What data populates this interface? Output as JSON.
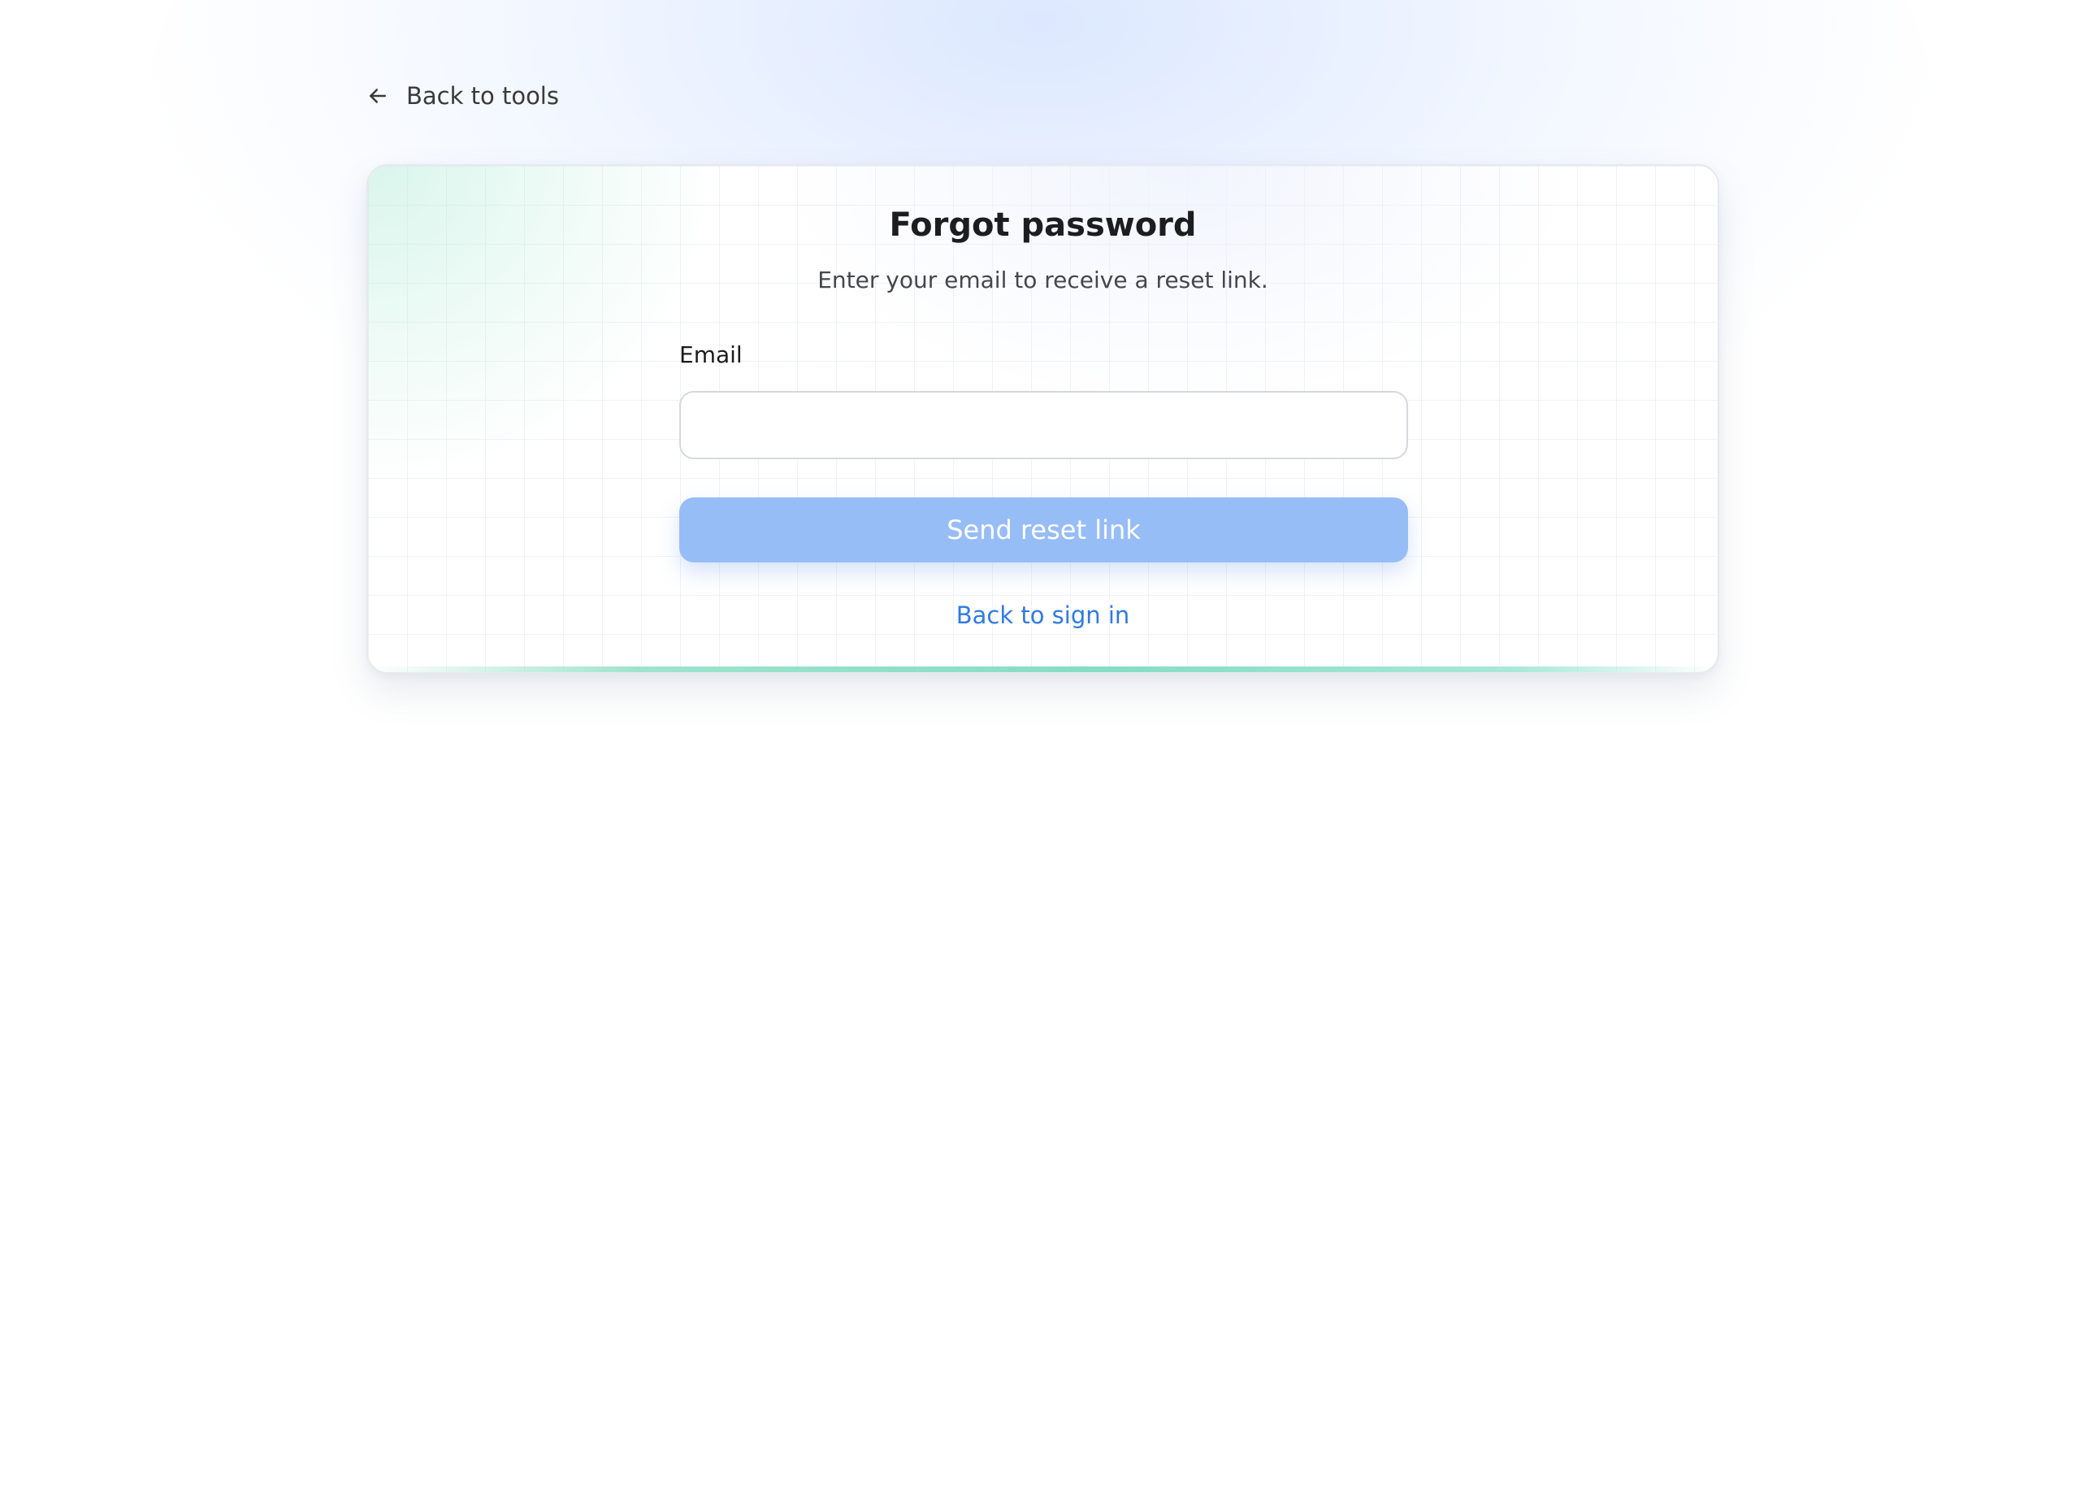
{
  "nav": {
    "back_label": "Back to tools",
    "back_icon": "arrow-left-icon"
  },
  "form": {
    "title": "Forgot password",
    "subtitle": "Enter your email to receive a reset link.",
    "email_label": "Email",
    "email_value": "",
    "submit_label": "Send reset link",
    "signin_link": "Back to sign in"
  },
  "colors": {
    "accent_link": "#2f7ae5",
    "button_disabled": "#97bdf7",
    "bottom_accent": "#86dcc4"
  }
}
